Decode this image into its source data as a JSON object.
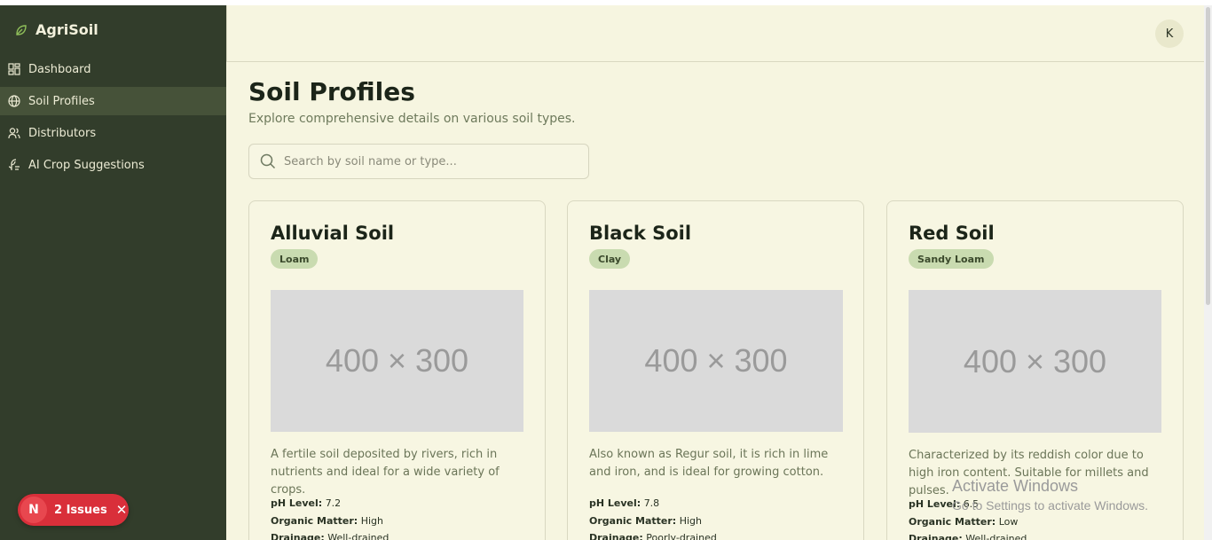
{
  "brand": {
    "name": "AgriSoil",
    "icon": "leaf-icon"
  },
  "sidebar": {
    "items": [
      {
        "label": "Dashboard",
        "icon": "dashboard-icon",
        "active": false
      },
      {
        "label": "Soil Profiles",
        "icon": "globe-icon",
        "active": true
      },
      {
        "label": "Distributors",
        "icon": "users-icon",
        "active": false
      },
      {
        "label": "AI Crop Suggestions",
        "icon": "ai-leaf-icon",
        "active": false
      }
    ]
  },
  "header": {
    "avatar_initial": "K"
  },
  "page": {
    "title": "Soil Profiles",
    "subtitle": "Explore comprehensive details on various soil types."
  },
  "search": {
    "placeholder": "Search by soil name or type...",
    "value": ""
  },
  "cards": [
    {
      "title": "Alluvial Soil",
      "badge": "Loam",
      "image_placeholder": "400 × 300",
      "description": "A fertile soil deposited by rivers, rich in nutrients and ideal for a wide variety of crops.",
      "ph_label": "pH Level:",
      "ph_value": "7.2",
      "organic_label": "Organic Matter:",
      "organic_value": "High",
      "drainage_label": "Drainage:",
      "drainage_value": "Well-drained"
    },
    {
      "title": "Black Soil",
      "badge": "Clay",
      "image_placeholder": "400 × 300",
      "description": "Also known as Regur soil, it is rich in lime and iron, and is ideal for growing cotton.",
      "ph_label": "pH Level:",
      "ph_value": "7.8",
      "organic_label": "Organic Matter:",
      "organic_value": "High",
      "drainage_label": "Drainage:",
      "drainage_value": "Poorly-drained"
    },
    {
      "title": "Red Soil",
      "badge": "Sandy Loam",
      "image_placeholder": "400 × 300",
      "description": "Characterized by its reddish color due to high iron content. Suitable for millets and pulses.",
      "ph_label": "pH Level:",
      "ph_value": "6.5",
      "organic_label": "Organic Matter:",
      "organic_value": "Low",
      "drainage_label": "Drainage:",
      "drainage_value": "Well-drained"
    }
  ],
  "issues_badge": {
    "letter": "N",
    "label": "2 Issues"
  },
  "watermark": {
    "line1": "Activate Windows",
    "line2": "Go to Settings to activate Windows."
  },
  "colors": {
    "sidebar": "#323d2b",
    "background": "#f6f5e0",
    "badge": "#c9dbb0",
    "issues": "#d92f3a"
  }
}
